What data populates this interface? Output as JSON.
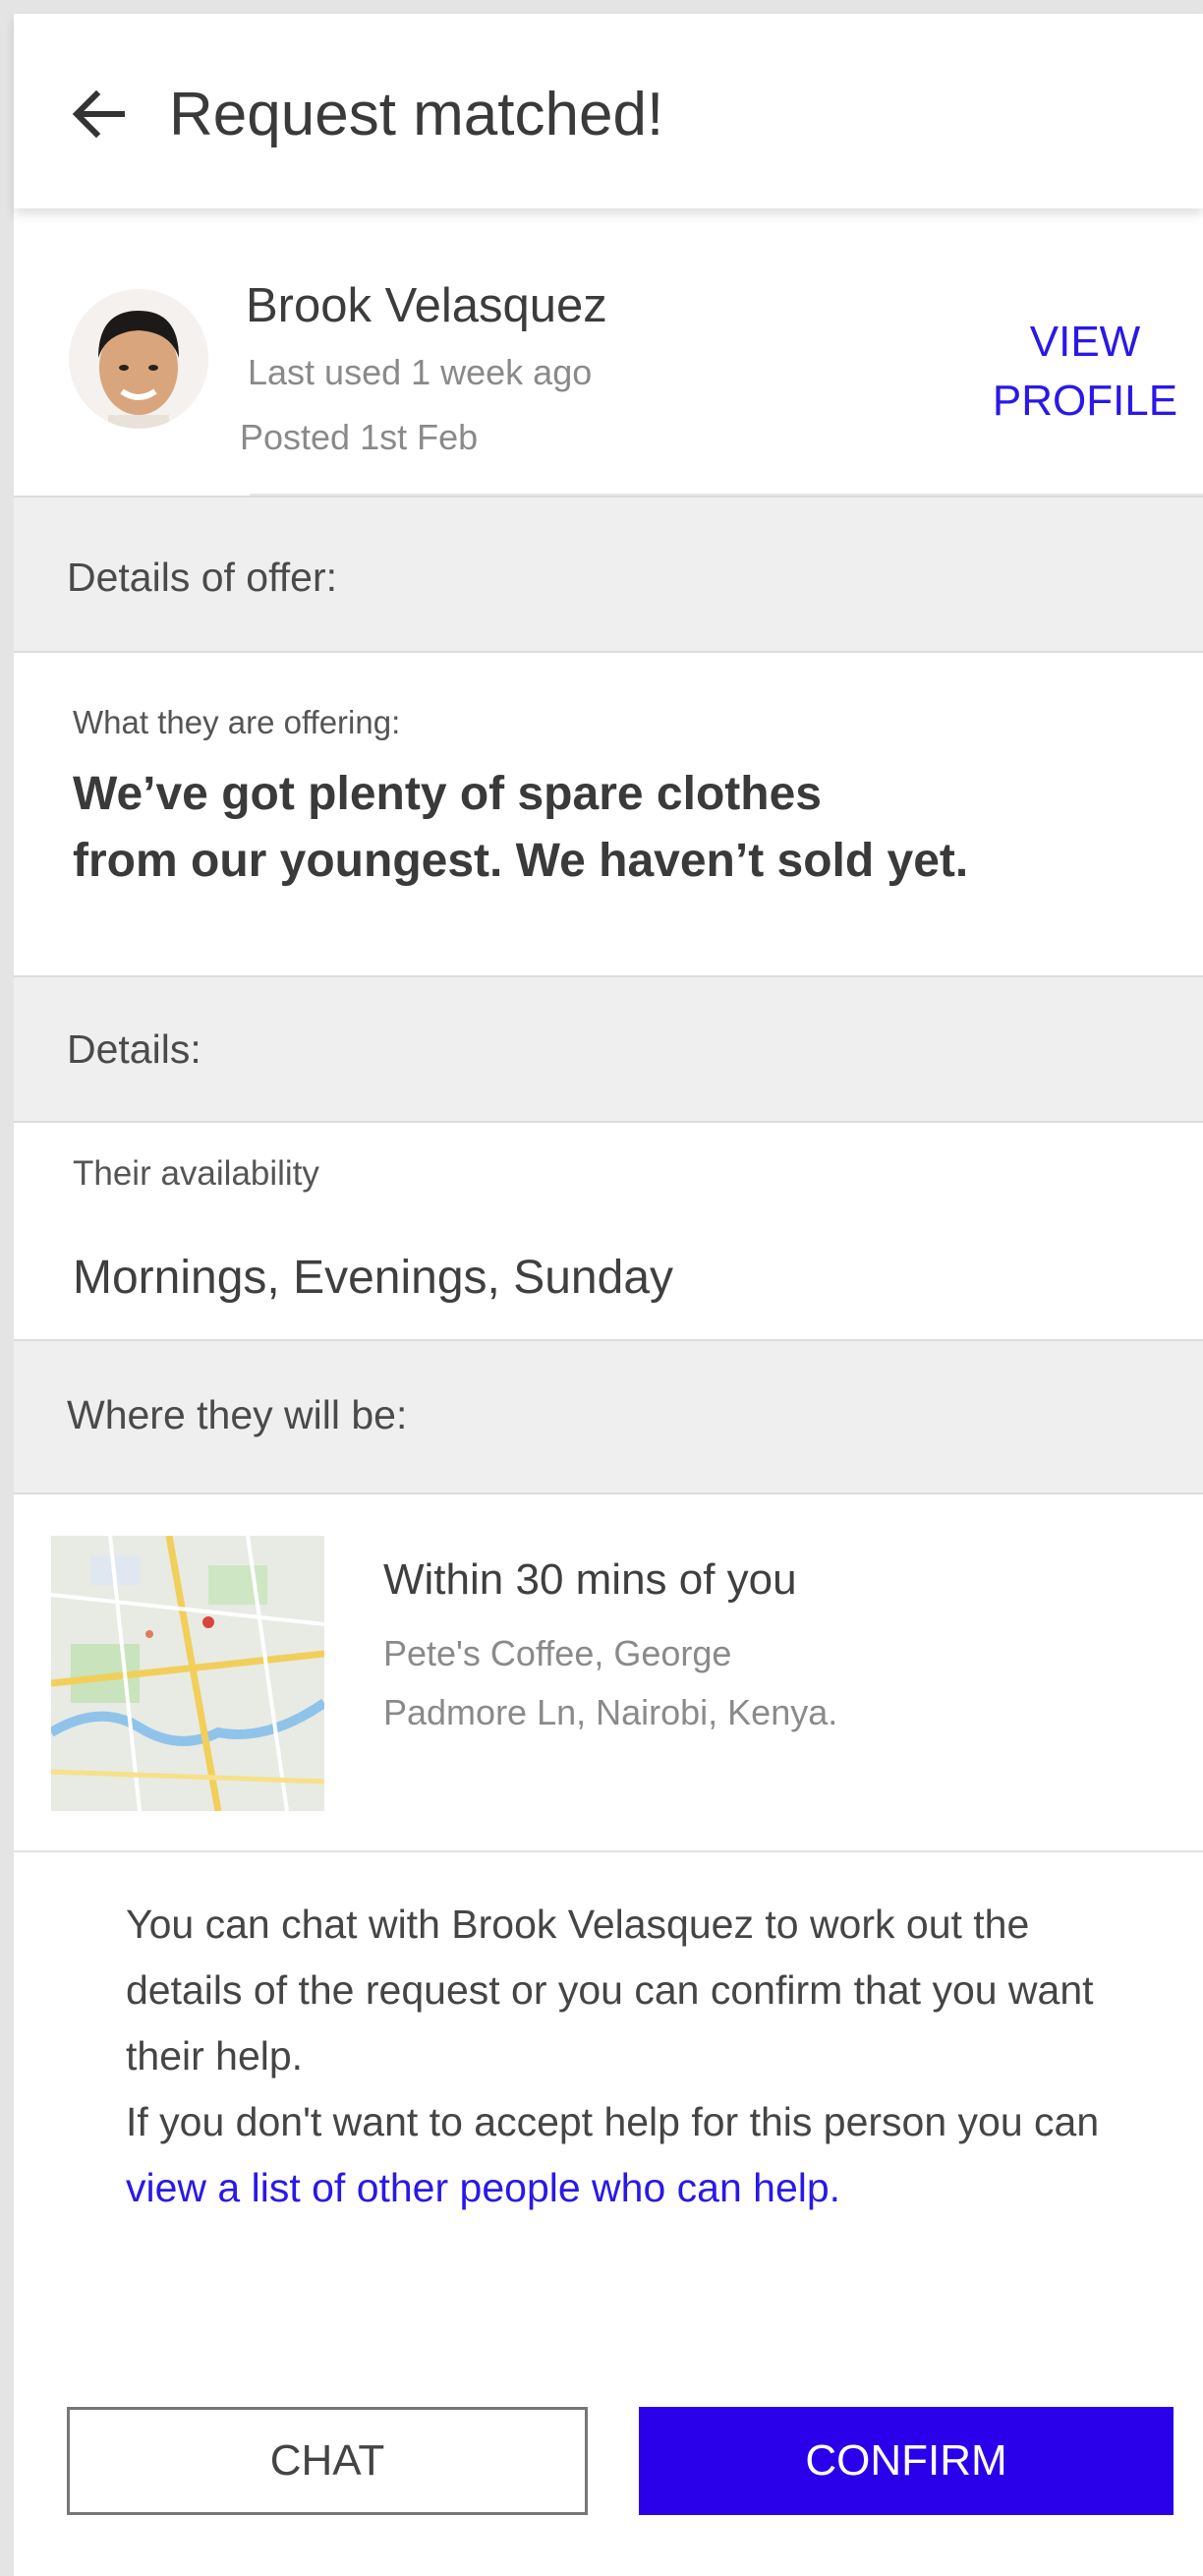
{
  "header": {
    "title": "Request matched!",
    "back_icon": "arrow-left-icon"
  },
  "profile": {
    "name": "Brook Velasquez",
    "last_used": "Last used 1 week ago",
    "posted": "Posted 1st Feb",
    "view_profile_line1": "VIEW",
    "view_profile_line2": "PROFILE"
  },
  "offer": {
    "section_title": "Details of offer:",
    "label": "What they are offering:",
    "text_line1": "We’ve got plenty of spare clothes",
    "text_line2": "from our youngest. We haven’t sold yet."
  },
  "details": {
    "section_title": "Details:",
    "availability_label": "Their availability",
    "availability_value": "Mornings, Evenings, Sunday"
  },
  "location": {
    "section_title": "Where they will be:",
    "summary": "Within 30 mins of you",
    "address_line1": "Pete's Coffee, George",
    "address_line2": "Padmore Ln, Nairobi, Kenya."
  },
  "info": {
    "text_before_link": "You can chat with Brook Velasquez to work out the details of the request or you can confirm that you want their help.",
    "text_second_line": "If you don't want to accept help for this person you can ",
    "link_text": "view a list of other people who can help."
  },
  "actions": {
    "chat_label": "CHAT",
    "confirm_label": "CONFIRM"
  },
  "colors": {
    "accent": "#2a00ea",
    "link": "#2a18e8",
    "section_bg": "#efefef"
  }
}
